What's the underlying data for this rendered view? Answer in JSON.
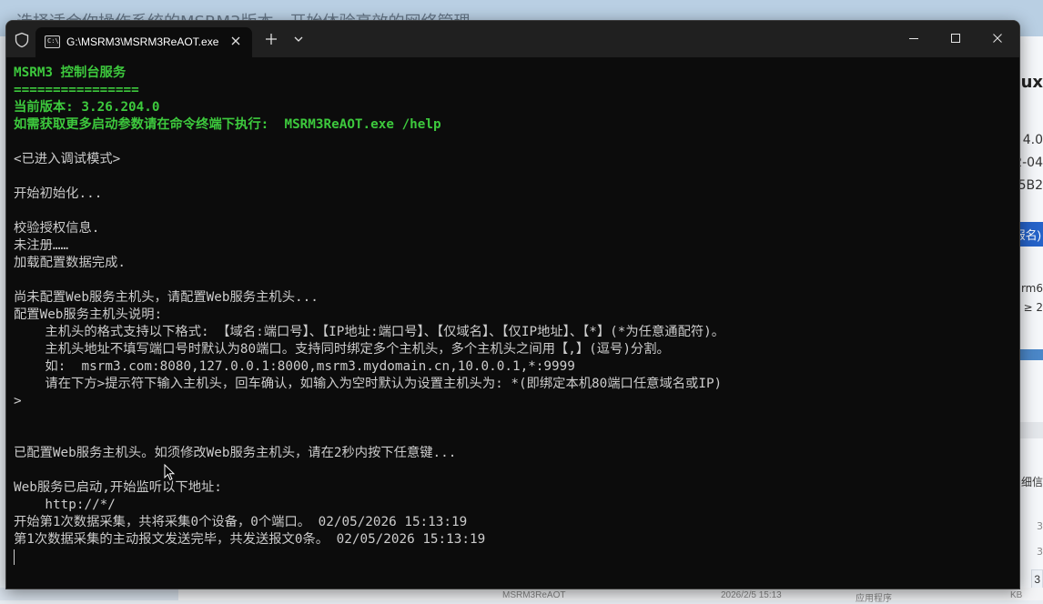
{
  "background": {
    "top_text": "选择适合你操作系统的MSRM3版本，开始体验高效的网络管理",
    "right": {
      "title": "ux",
      "version": "4.0",
      "date": "2-04",
      "hash": "65B2",
      "button": "服名)",
      "arch": "arm6",
      "req": "≥ 2",
      "detail": "细信",
      "num1": "3",
      "num2": "3",
      "num3": "3"
    },
    "bottom": {
      "file": "MSRM3ReAOT",
      "date": "2026/2/5 15:13",
      "type": "应用程序",
      "size": "KB"
    }
  },
  "window": {
    "tab_title": "G:\\MSRM3\\MSRM3ReAOT.exe",
    "tab_icon_text": "C:\\"
  },
  "console": {
    "lines": [
      {
        "text": "MSRM3 控制台服务",
        "style": "green"
      },
      {
        "text": "================",
        "style": "green"
      },
      {
        "text": "当前版本: 3.26.204.0",
        "style": "green"
      },
      {
        "text": "如需获取更多启动参数请在命令终端下执行:  MSRM3ReAOT.exe /help",
        "style": "green"
      },
      {
        "text": "",
        "style": "white"
      },
      {
        "text": "<已进入调试模式>",
        "style": "white"
      },
      {
        "text": "",
        "style": "white"
      },
      {
        "text": "开始初始化...",
        "style": "white"
      },
      {
        "text": "",
        "style": "white"
      },
      {
        "text": "校验授权信息.",
        "style": "white"
      },
      {
        "text": "未注册……",
        "style": "white"
      },
      {
        "text": "加载配置数据完成.",
        "style": "white"
      },
      {
        "text": "",
        "style": "white"
      },
      {
        "text": "尚未配置Web服务主机头，请配置Web服务主机头...",
        "style": "white"
      },
      {
        "text": "配置Web服务主机头说明:",
        "style": "white"
      },
      {
        "text": "    主机头的格式支持以下格式: 【域名:端口号】、【IP地址:端口号】、【仅域名】、【仅IP地址】、【*】(*为任意通配符)。",
        "style": "white"
      },
      {
        "text": "    主机头地址不填写端口号时默认为80端口。支持同时绑定多个主机头，多个主机头之间用【,】(逗号)分割。",
        "style": "white"
      },
      {
        "text": "    如:  msrm3.com:8080,127.0.0.1:8000,msrm3.mydomain.cn,10.0.0.1,*:9999",
        "style": "white"
      },
      {
        "text": "    请在下方>提示符下输入主机头，回车确认，如输入为空时默认为设置主机头为: *(即绑定本机80端口任意域名或IP)",
        "style": "white"
      },
      {
        "text": ">",
        "style": "white"
      },
      {
        "text": "",
        "style": "white"
      },
      {
        "text": "",
        "style": "white"
      },
      {
        "text": "已配置Web服务主机头。如须修改Web服务主机头，请在2秒内按下任意键...",
        "style": "white"
      },
      {
        "text": "",
        "style": "white"
      },
      {
        "text": "Web服务已启动,开始监听以下地址:",
        "style": "white"
      },
      {
        "text": "    http://*/",
        "style": "white"
      },
      {
        "text": "开始第1次数据采集，共将采集0个设备，0个端口。 02/05/2026 15:13:19",
        "style": "white"
      },
      {
        "text": "第1次数据采集的主动报文发送完毕，共发送报文0条。 02/05/2026 15:13:19",
        "style": "white"
      }
    ]
  },
  "colors": {
    "terminal_bg": "#0c0c0c",
    "titlebar_bg": "#202020",
    "green_text": "#3dc93d",
    "text": "#cccccc"
  },
  "icons": {
    "shield": "shield-icon",
    "close_tab": "close-icon",
    "new_tab": "plus-icon",
    "dropdown": "chevron-down-icon",
    "minimize": "minimize-icon",
    "maximize": "maximize-icon",
    "close_window": "close-icon"
  }
}
